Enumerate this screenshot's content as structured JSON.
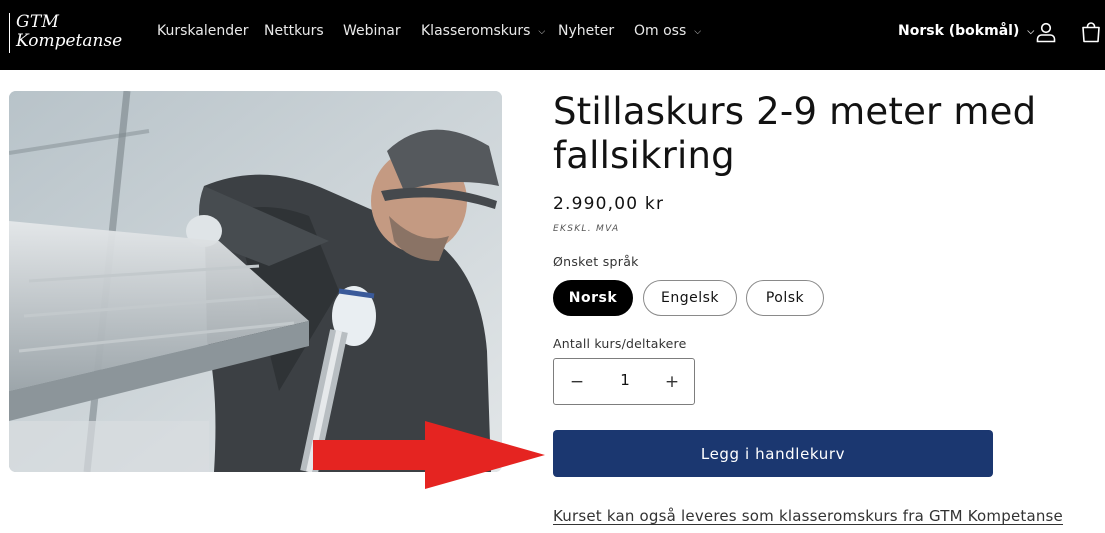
{
  "header": {
    "logo": {
      "line1": "GTM",
      "line2": "Kompetanse"
    },
    "nav": [
      {
        "label": "Kurskalender",
        "has_dropdown": false
      },
      {
        "label": "Nettkurs",
        "has_dropdown": false
      },
      {
        "label": "Webinar",
        "has_dropdown": false
      },
      {
        "label": "Klasseromskurs",
        "has_dropdown": true
      },
      {
        "label": "Nyheter",
        "has_dropdown": false
      },
      {
        "label": "Om oss",
        "has_dropdown": true
      }
    ],
    "language_selector": "Norsk (bokmål)",
    "icons": [
      "user-icon",
      "cart-icon"
    ]
  },
  "product": {
    "title": "Stillaskurs 2-9 meter med fallsikring",
    "price": "2.990,00 kr",
    "tax_note": "EKSKL. MVA",
    "language_label": "Ønsket språk",
    "language_options": [
      {
        "label": "Norsk",
        "selected": true
      },
      {
        "label": "Engelsk",
        "selected": false
      },
      {
        "label": "Polsk",
        "selected": false
      }
    ],
    "quantity_label": "Antall kurs/deltakere",
    "quantity": "1",
    "quantity_decrease_symbol": "−",
    "quantity_increase_symbol": "+",
    "add_to_cart_label": "Legg i handlekurv",
    "classroom_link": "Kurset kan også leveres som klasseromskurs fra GTM Kompetanse"
  },
  "colors": {
    "header_bg": "#000000",
    "button_primary": "#1b3770",
    "arrow": "#e52421"
  }
}
